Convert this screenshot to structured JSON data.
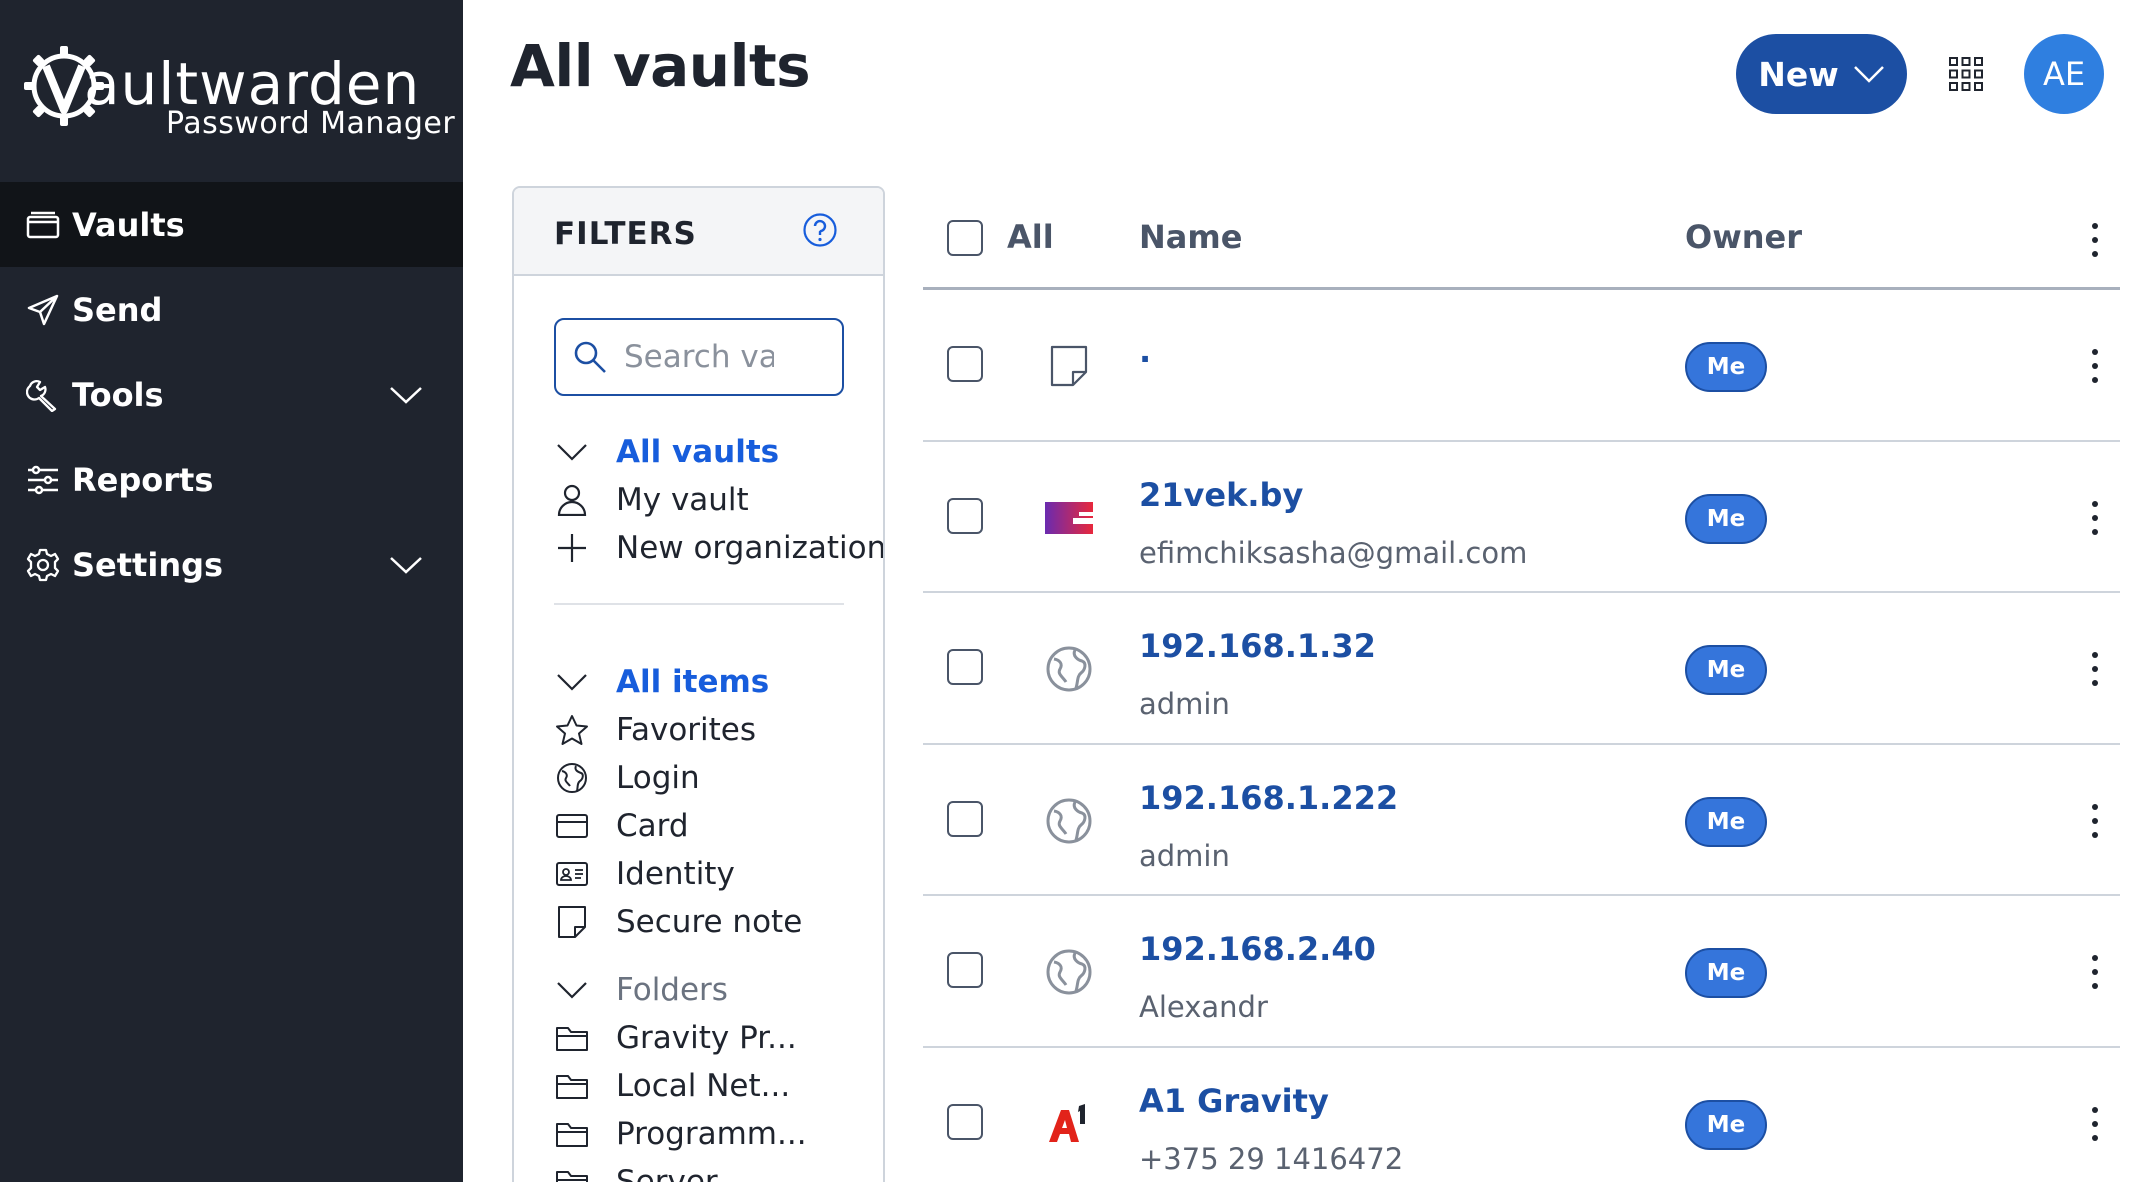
{
  "app": {
    "logo_word_bold": "V",
    "logo_word": "aultwarden",
    "logo_sub": "Password Manager"
  },
  "sidebar": {
    "items": [
      {
        "label": "Vaults",
        "icon": "vault-icon",
        "active": true
      },
      {
        "label": "Send",
        "icon": "send-icon"
      },
      {
        "label": "Tools",
        "icon": "wrench-icon",
        "expandable": true
      },
      {
        "label": "Reports",
        "icon": "sliders-icon"
      },
      {
        "label": "Settings",
        "icon": "gear-icon",
        "expandable": true
      }
    ]
  },
  "header": {
    "title": "All vaults",
    "new_label": "New",
    "avatar_initials": "AE"
  },
  "filters": {
    "title": "FILTERS",
    "search_placeholder": "Search vault",
    "vaults": [
      {
        "label": "All vaults",
        "icon": "chevron-down-icon",
        "selected": true
      },
      {
        "label": "My vault",
        "icon": "user-icon"
      },
      {
        "label": "New organization",
        "icon": "plus-icon"
      }
    ],
    "types": [
      {
        "label": "All items",
        "icon": "chevron-down-icon",
        "selected": true
      },
      {
        "label": "Favorites",
        "icon": "star-icon"
      },
      {
        "label": "Login",
        "icon": "globe-icon"
      },
      {
        "label": "Card",
        "icon": "credit-card-icon"
      },
      {
        "label": "Identity",
        "icon": "id-card-icon"
      },
      {
        "label": "Secure note",
        "icon": "note-icon"
      }
    ],
    "folders_label": "Folders",
    "folders": [
      {
        "label": "Gravity Pr..."
      },
      {
        "label": "Local Net..."
      },
      {
        "label": "Programm..."
      },
      {
        "label": "Server"
      }
    ]
  },
  "table": {
    "col_all": "All",
    "col_name": "Name",
    "col_owner": "Owner",
    "rows": [
      {
        "name": ".",
        "sub": "",
        "icon": "note-icon",
        "owner": "Me"
      },
      {
        "name": "21vek.by",
        "sub": "efimchiksasha@gmail.com",
        "icon": "21vek-logo-icon",
        "owner": "Me"
      },
      {
        "name": "192.168.1.32",
        "sub": "admin",
        "icon": "globe-icon",
        "owner": "Me"
      },
      {
        "name": "192.168.1.222",
        "sub": "admin",
        "icon": "globe-icon",
        "owner": "Me"
      },
      {
        "name": "192.168.2.40",
        "sub": "Alexandr",
        "icon": "globe-icon",
        "owner": "Me"
      },
      {
        "name": "A1 Gravity",
        "sub": "+375 29 1416472",
        "icon": "a1-logo-icon",
        "owner": "Me"
      }
    ]
  },
  "colors": {
    "sidebar_bg": "#1f242e",
    "sidebar_active": "#111418",
    "primary": "#1c4fa3",
    "link": "#175ddc",
    "badge": "#3575db",
    "avatar": "#2f7fe0"
  }
}
